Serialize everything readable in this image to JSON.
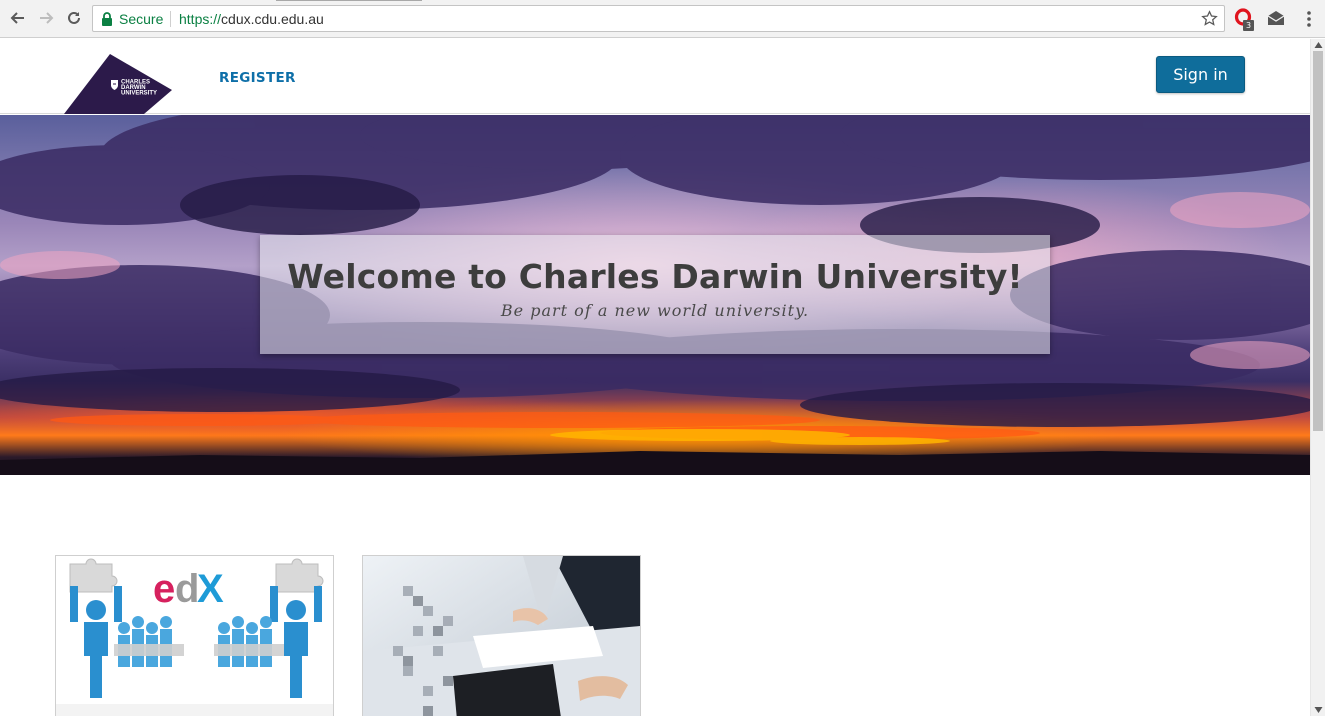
{
  "browser": {
    "secure_label": "Secure",
    "url_protocol": "https://",
    "url_host": "cdux.cdu.edu.au",
    "extension_badge": "3",
    "icons": [
      "back-arrow-icon",
      "forward-arrow-icon",
      "reload-icon",
      "lock-icon",
      "star-icon",
      "opera-extension-icon",
      "mail-extension-icon",
      "kebab-menu-icon"
    ]
  },
  "header": {
    "logo_lines": [
      "CHARLES",
      "DARWIN",
      "UNIVERSITY"
    ],
    "register_label": "REGISTER",
    "signin_label": "Sign in"
  },
  "hero": {
    "title": "Welcome to Charles Darwin University!",
    "subtitle": "Be part of a new world university."
  },
  "cards": [
    {
      "image": "edx-teamwork-puzzle-image",
      "brand_text": "edX"
    },
    {
      "image": "business-meeting-image"
    }
  ],
  "colors": {
    "brand_purple": "#2c1a4a",
    "link_blue": "#0e6fa8",
    "signin_bg": "#0f6d9b",
    "secure_green": "#0b8043"
  }
}
